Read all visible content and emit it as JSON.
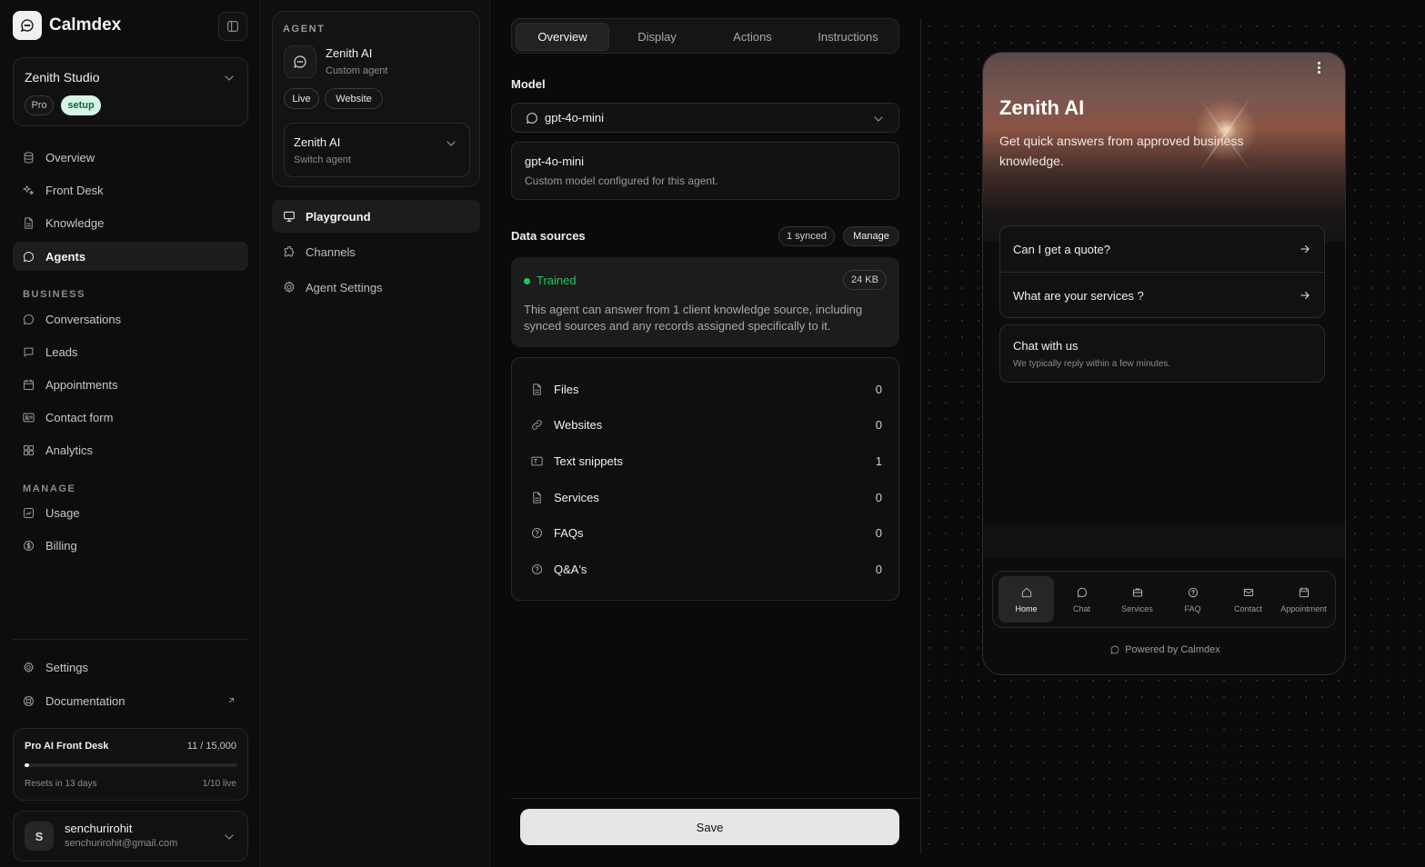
{
  "brand": {
    "name": "Calmdex"
  },
  "workspace": {
    "name": "Zenith Studio",
    "plan_badge": "Pro",
    "status_badge": "setup"
  },
  "nav": {
    "main": [
      {
        "label": "Overview",
        "icon": "database-icon"
      },
      {
        "label": "Front Desk",
        "icon": "sparkles-icon"
      },
      {
        "label": "Knowledge",
        "icon": "file-icon"
      },
      {
        "label": "Agents",
        "icon": "chat-bubble-icon",
        "active": true
      }
    ],
    "business_label": "BUSINESS",
    "business": [
      {
        "label": "Conversations",
        "icon": "chat-bubble-icon"
      },
      {
        "label": "Leads",
        "icon": "message-square-icon"
      },
      {
        "label": "Appointments",
        "icon": "calendar-icon"
      },
      {
        "label": "Contact form",
        "icon": "contact-card-icon"
      },
      {
        "label": "Analytics",
        "icon": "grid-icon"
      }
    ],
    "manage_label": "MANAGE",
    "manage": [
      {
        "label": "Usage",
        "icon": "chart-icon"
      },
      {
        "label": "Billing",
        "icon": "dollar-icon"
      }
    ],
    "footer": [
      {
        "label": "Settings",
        "icon": "gear-icon"
      },
      {
        "label": "Documentation",
        "icon": "lifebuoy-icon"
      }
    ]
  },
  "plan": {
    "title": "Pro AI Front Desk",
    "count": "11 / 15,000",
    "progress_fraction": 0.0007,
    "reset": "Resets in 13 days",
    "live": "1/10 live"
  },
  "user": {
    "initial": "S",
    "name": "senchurirohit",
    "email": "senchurirohit@gmail.com"
  },
  "agent": {
    "section_label": "AGENT",
    "name": "Zenith AI",
    "type": "Custom agent",
    "tags": [
      "Live",
      "Website"
    ],
    "switcher": {
      "name": "Zenith AI",
      "sub": "Switch agent"
    },
    "menu": [
      {
        "label": "Playground",
        "icon": "monitor-icon",
        "active": true
      },
      {
        "label": "Channels",
        "icon": "puzzle-icon"
      },
      {
        "label": "Agent Settings",
        "icon": "gear-icon"
      }
    ]
  },
  "tabs": [
    "Overview",
    "Display",
    "Actions",
    "Instructions"
  ],
  "active_tab": "Overview",
  "model": {
    "label": "Model",
    "selected": "gpt-4o-mini",
    "card_title": "gpt-4o-mini",
    "card_sub": "Custom model configured for this agent."
  },
  "data_sources": {
    "label": "Data sources",
    "synced_badge": "1 synced",
    "manage_label": "Manage",
    "status": "Trained",
    "size": "24 KB",
    "description": "This agent can answer from 1 client knowledge source, including synced sources and any records assigned specifically to it.",
    "items": [
      {
        "name": "Files",
        "count": "0",
        "icon": "file-icon"
      },
      {
        "name": "Websites",
        "count": "0",
        "icon": "link-icon"
      },
      {
        "name": "Text snippets",
        "count": "1",
        "icon": "text-box-icon"
      },
      {
        "name": "Services",
        "count": "0",
        "icon": "file-icon"
      },
      {
        "name": "FAQs",
        "count": "0",
        "icon": "help-circle-icon"
      },
      {
        "name": "Q&A's",
        "count": "0",
        "icon": "help-circle-icon"
      }
    ]
  },
  "save_label": "Save",
  "widget": {
    "title": "Zenith AI",
    "subtitle": "Get quick answers from approved business knowledge.",
    "questions": [
      "Can I get a quote?",
      "What are your services ?"
    ],
    "chat_title": "Chat with us",
    "chat_sub": "We typically reply within a few minutes.",
    "nav": [
      {
        "label": "Home",
        "icon": "home-icon",
        "active": true
      },
      {
        "label": "Chat",
        "icon": "chat-bubble-icon"
      },
      {
        "label": "Services",
        "icon": "briefcase-icon"
      },
      {
        "label": "FAQ",
        "icon": "help-circle-icon"
      },
      {
        "label": "Contact",
        "icon": "mail-icon"
      },
      {
        "label": "Appointment",
        "icon": "calendar-icon"
      }
    ],
    "powered_by": "Powered by Calmdex"
  }
}
